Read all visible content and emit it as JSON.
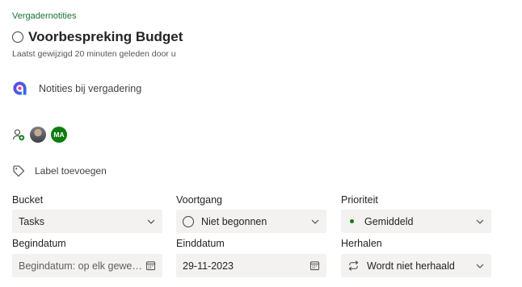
{
  "header": {
    "breadcrumb": "Vergadernotities",
    "title": "Voorbespreking Budget",
    "last_modified": "Laatst gewijzigd 20 minuten geleden door u"
  },
  "notes": {
    "label": "Notities bij vergadering",
    "icon": "loop-icon"
  },
  "assignees": {
    "add_icon": "add-person-icon",
    "users": [
      {
        "type": "photo"
      },
      {
        "initials": "MA",
        "color": "#107c10"
      }
    ]
  },
  "labels": {
    "add_label": "Label toevoegen",
    "icon": "tag-icon"
  },
  "fields": {
    "bucket": {
      "label": "Bucket",
      "value": "Tasks"
    },
    "progress": {
      "label": "Voortgang",
      "value": "Niet begonnen"
    },
    "priority": {
      "label": "Prioriteit",
      "value": "Gemiddeld",
      "dot_color": "#107c10"
    },
    "start_date": {
      "label": "Begindatum",
      "placeholder": "Begindatum: op elk gewens..."
    },
    "due_date": {
      "label": "Einddatum",
      "value": "29-11-2023"
    },
    "repeat": {
      "label": "Herhalen",
      "value": "Wordt niet herhaald"
    }
  },
  "colors": {
    "accent_green": "#1b6f3a",
    "field_bg": "#f3f2f1"
  }
}
